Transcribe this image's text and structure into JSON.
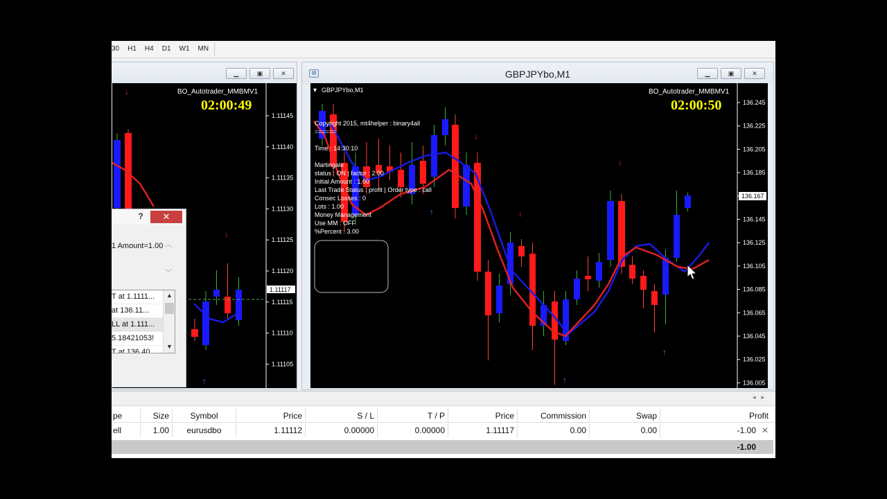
{
  "timeframes": [
    "30",
    "H1",
    "H4",
    "D1",
    "W1",
    "MN"
  ],
  "left_window": {
    "indicator": "BO_Autotrader_MMBMV1",
    "timer": "02:00:49",
    "prices": [
      "1.11145",
      "1.11140",
      "1.11135",
      "1.11130",
      "1.11125",
      "1.11120",
      "1.11115",
      "1.11110",
      "1.11105"
    ],
    "current_price": "1.11117"
  },
  "right_window": {
    "title": "GBPJPYbo,M1",
    "symbol_label": "GBPJPYbo,M1",
    "indicator": "BO_Autotrader_MMBMV1",
    "timer": "02:00:50",
    "prices": [
      "136.245",
      "136.225",
      "136.205",
      "136.185",
      "136.165",
      "136.145",
      "136.125",
      "136.105",
      "136.085",
      "136.065",
      "136.045",
      "136.025",
      "136.005"
    ],
    "current_price": "136.167",
    "info_lines": [
      "Copyright 2015, mt4helper : binary4all",
      "======",
      "Time : 14:30:10",
      "Martingale",
      "status : ON | factor : 2.00",
      "Initial Amount : 1.00",
      "Last Trade Status : profit | Order type : call",
      "Consec Losses : 0",
      "Lots : 1.00",
      "Money Management",
      "Use MM : OFF",
      "%Percent : 3.00"
    ]
  },
  "dialog": {
    "help": "?",
    "close": "✕",
    "param": "1 Amount=1.00",
    "list": [
      "T at 1.1111...",
      "at 136.11...",
      "LL at 1.111...",
      "5.18421053!",
      "T at 136.40"
    ]
  },
  "terminal": {
    "headers": [
      "pe",
      "Size",
      "Symbol",
      "Price",
      "S / L",
      "T / P",
      "Price",
      "Commission",
      "Swap",
      "Profit"
    ],
    "trade": [
      "ell",
      "1.00",
      "eurusdbo",
      "1.11112",
      "0.00000",
      "0.00000",
      "1.11117",
      "0.00",
      "0.00",
      "-1.00"
    ],
    "total_profit": "-1.00"
  }
}
